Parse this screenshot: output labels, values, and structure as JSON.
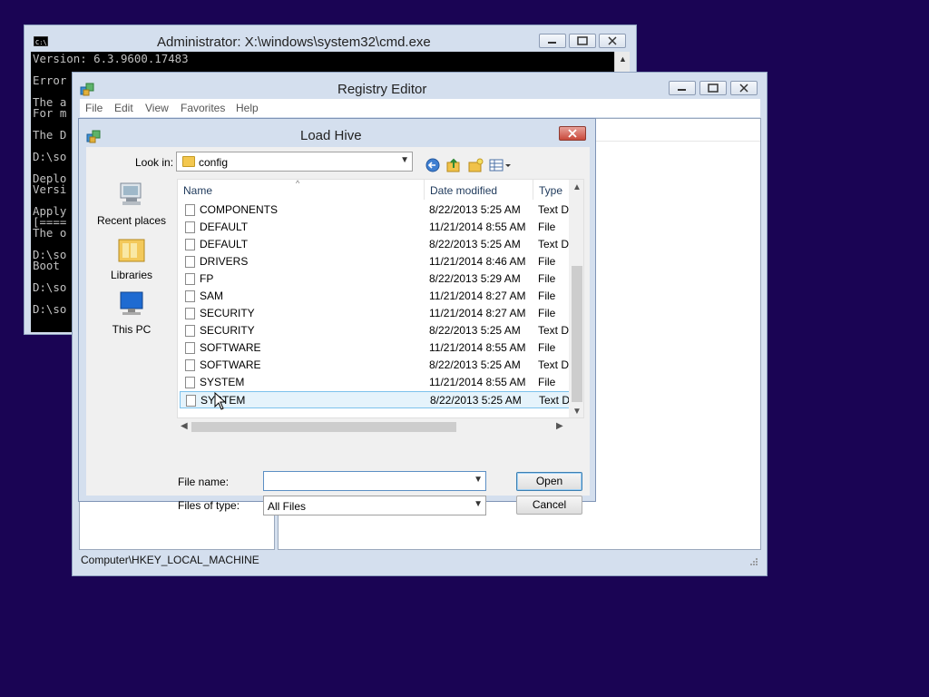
{
  "cmd": {
    "title": "Administrator: X:\\windows\\system32\\cmd.exe",
    "lines": [
      "Version: 6.3.9600.17483",
      "",
      "Error",
      "",
      "The a",
      "For m",
      "",
      "The D",
      "",
      "D:\\so",
      "",
      "Deplo",
      "Versi",
      "",
      "Apply",
      "[====",
      "The o",
      "",
      "D:\\so",
      "Boot",
      "",
      "D:\\so",
      "",
      "D:\\so"
    ]
  },
  "regedit": {
    "title": "Registry Editor",
    "menu": [
      "File",
      "Edit",
      "View",
      "Favorites",
      "Help"
    ],
    "status": "Computer\\HKEY_LOCAL_MACHINE"
  },
  "loadhive": {
    "title": "Load Hive",
    "look_in_label": "Look in:",
    "look_in_value": "config",
    "places": [
      "Recent places",
      "Libraries",
      "This PC"
    ],
    "columns": [
      "Name",
      "Date modified",
      "Type"
    ],
    "files": [
      {
        "name": "COMPONENTS",
        "date": "8/22/2013 5:25 AM",
        "type": "Text Do"
      },
      {
        "name": "DEFAULT",
        "date": "11/21/2014 8:55 AM",
        "type": "File"
      },
      {
        "name": "DEFAULT",
        "date": "8/22/2013 5:25 AM",
        "type": "Text Do"
      },
      {
        "name": "DRIVERS",
        "date": "11/21/2014 8:46 AM",
        "type": "File"
      },
      {
        "name": "FP",
        "date": "8/22/2013 5:29 AM",
        "type": "File"
      },
      {
        "name": "SAM",
        "date": "11/21/2014 8:27 AM",
        "type": "File"
      },
      {
        "name": "SECURITY",
        "date": "11/21/2014 8:27 AM",
        "type": "File"
      },
      {
        "name": "SECURITY",
        "date": "8/22/2013 5:25 AM",
        "type": "Text Do"
      },
      {
        "name": "SOFTWARE",
        "date": "11/21/2014 8:55 AM",
        "type": "File"
      },
      {
        "name": "SOFTWARE",
        "date": "8/22/2013 5:25 AM",
        "type": "Text Do"
      },
      {
        "name": "SYSTEM",
        "date": "11/21/2014 8:55 AM",
        "type": "File"
      },
      {
        "name": "SYSTEM",
        "date": "8/22/2013 5:25 AM",
        "type": "Text Do"
      }
    ],
    "selected_index": 11,
    "file_name_label": "File name:",
    "file_name_value": "",
    "files_of_type_label": "Files of type:",
    "files_of_type_value": "All Files",
    "open_label": "Open",
    "cancel_label": "Cancel"
  }
}
